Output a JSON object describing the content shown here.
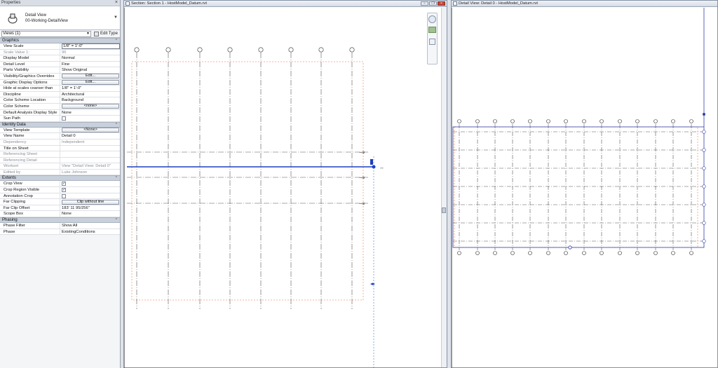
{
  "properties": {
    "title": "Properties",
    "type": {
      "name": "Detail View",
      "subname": "00-Working-DetailView"
    },
    "views_selector": "Views (1)",
    "edit_type_label": "Edit Type",
    "sections": [
      {
        "name": "Graphics",
        "rows": [
          {
            "k": "View Scale",
            "v": "1/8\" = 1'-0\"",
            "kind": "input"
          },
          {
            "k": "Scale Value    1:",
            "v": "96",
            "kind": "dim"
          },
          {
            "k": "Display Model",
            "v": "Normal"
          },
          {
            "k": "Detail Level",
            "v": "Fine"
          },
          {
            "k": "Parts Visibility",
            "v": "Show Original"
          },
          {
            "k": "Visibility/Graphics Overrides",
            "v": "Edit...",
            "kind": "button"
          },
          {
            "k": "Graphic Display Options",
            "v": "Edit...",
            "kind": "button"
          },
          {
            "k": "Hide at scales coarser than",
            "v": "1/8\" = 1'-0\""
          },
          {
            "k": "Discipline",
            "v": "Architectural"
          },
          {
            "k": "Color Scheme Location",
            "v": "Background"
          },
          {
            "k": "Color Scheme",
            "v": "<none>",
            "kind": "button"
          },
          {
            "k": "Default Analysis Display Style",
            "v": "None"
          },
          {
            "k": "Sun Path",
            "v": "",
            "kind": "check",
            "checked": false
          }
        ]
      },
      {
        "name": "Identity Data",
        "rows": [
          {
            "k": "View Template",
            "v": "<None>",
            "kind": "button"
          },
          {
            "k": "View Name",
            "v": "Detail 0"
          },
          {
            "k": "Dependency",
            "v": "Independent",
            "kind": "dim"
          },
          {
            "k": "Title on Sheet",
            "v": ""
          },
          {
            "k": "Referencing Sheet",
            "v": "",
            "kind": "dim"
          },
          {
            "k": "Referencing Detail",
            "v": "",
            "kind": "dim"
          },
          {
            "k": "Workset",
            "v": "View \"Detail View: Detail 0\"",
            "kind": "dim"
          },
          {
            "k": "Edited by",
            "v": "Luke Johnson",
            "kind": "dim"
          }
        ]
      },
      {
        "name": "Extents",
        "rows": [
          {
            "k": "Crop View",
            "v": "",
            "kind": "check",
            "checked": true
          },
          {
            "k": "Crop Region Visible",
            "v": "",
            "kind": "check",
            "checked": true
          },
          {
            "k": "Annotation Crop",
            "v": "",
            "kind": "check",
            "checked": false
          },
          {
            "k": "Far Clipping",
            "v": "Clip without line",
            "kind": "button"
          },
          {
            "k": "Far Clip Offset",
            "v": "183'  11 95/256\""
          },
          {
            "k": "Scope Box",
            "v": "None"
          }
        ]
      },
      {
        "name": "Phasing",
        "rows": [
          {
            "k": "Phase Filter",
            "v": "Show All"
          },
          {
            "k": "Phase",
            "v": "ExistingConditions"
          }
        ]
      }
    ]
  },
  "section_window": {
    "title": "Section: Section 1 - HostModel_Datum.rvt"
  },
  "detail_window": {
    "title": "Detail View: Detail 0 - HostModel_Datum.rvt"
  },
  "colors": {
    "grid_line": "#555555",
    "crop_region": "#f29a7c",
    "selected": "#1f3fbf"
  }
}
